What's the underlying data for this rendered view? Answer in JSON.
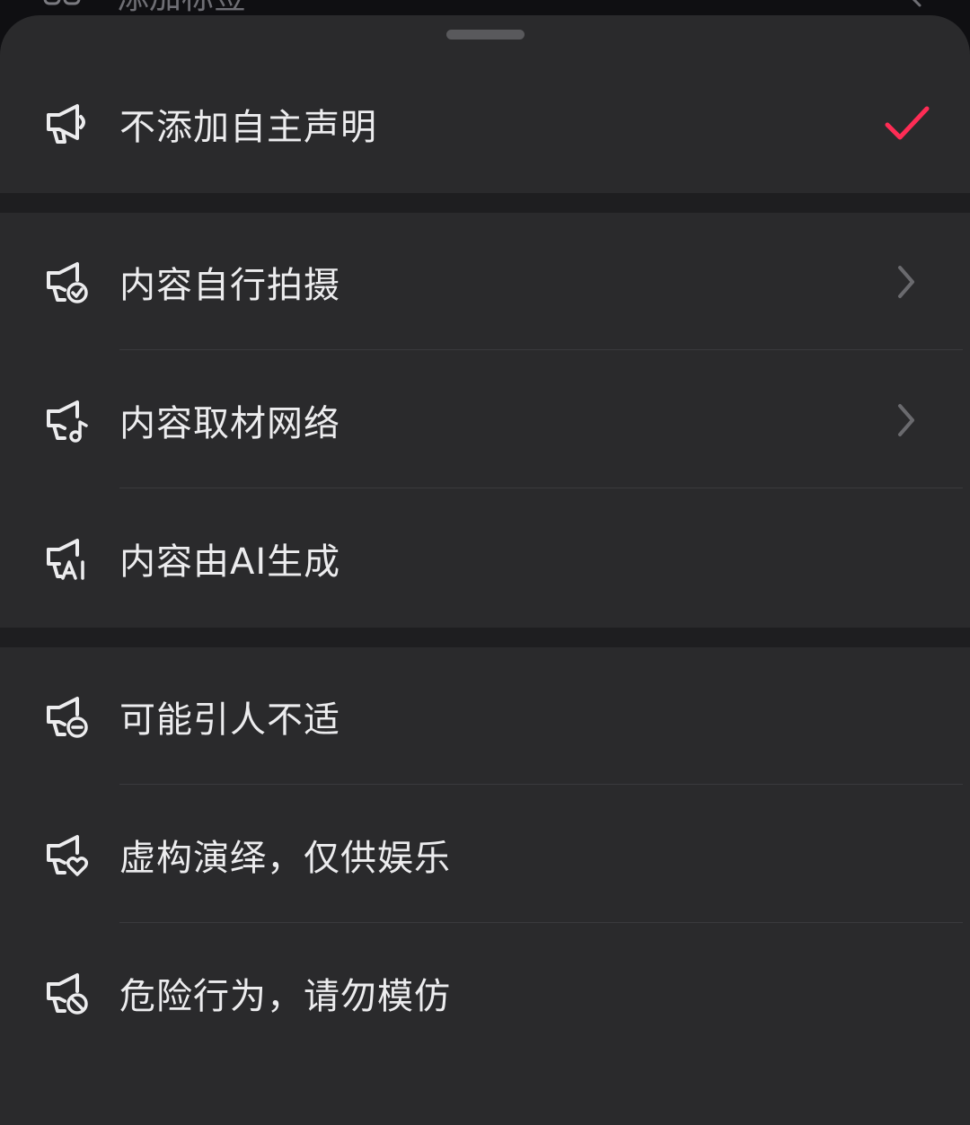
{
  "background_row": {
    "label": "添加标签",
    "icon": "tag-grid-icon"
  },
  "sheet": {
    "handle": "drag-handle",
    "accent_color": "#fe2c55",
    "options": [
      {
        "id": "none",
        "label": "不添加自主声明",
        "icon": "megaphone-icon",
        "selected": true,
        "has_chevron": false
      },
      {
        "id": "self-shot",
        "label": "内容自行拍摄",
        "icon": "megaphone-check-icon",
        "selected": false,
        "has_chevron": true
      },
      {
        "id": "from-web",
        "label": "内容取材网络",
        "icon": "megaphone-music-icon",
        "selected": false,
        "has_chevron": true
      },
      {
        "id": "ai-generated",
        "label": "内容由AI生成",
        "icon": "megaphone-ai-icon",
        "selected": false,
        "has_chevron": false
      },
      {
        "id": "discomfort",
        "label": "可能引人不适",
        "icon": "megaphone-minus-icon",
        "selected": false,
        "has_chevron": false
      },
      {
        "id": "fiction",
        "label": "虚构演绎，仅供娱乐",
        "icon": "megaphone-heart-icon",
        "selected": false,
        "has_chevron": false
      },
      {
        "id": "dangerous",
        "label": "危险行为，请勿模仿",
        "icon": "megaphone-ban-icon",
        "selected": false,
        "has_chevron": false
      }
    ]
  }
}
